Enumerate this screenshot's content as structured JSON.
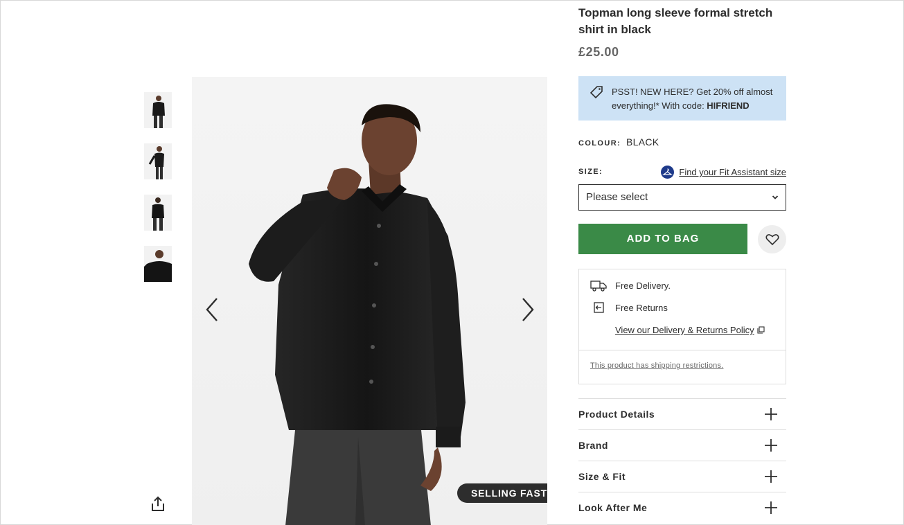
{
  "product": {
    "title": "Topman long sleeve formal stretch shirt in black",
    "price": "£25.00"
  },
  "promo": {
    "text": "PSST! NEW HERE? Get 20% off almost everything!* With code: ",
    "code": "HIFRIEND"
  },
  "colour": {
    "label": "COLOUR:",
    "value": "BLACK"
  },
  "size": {
    "label": "SIZE:",
    "fit_link": "Find your Fit Assistant size",
    "select_value": "Please select"
  },
  "actions": {
    "add_to_bag": "ADD TO BAG"
  },
  "delivery": {
    "free_delivery": "Free Delivery.",
    "free_returns": "Free Returns",
    "policy_link": "View our Delivery & Returns Policy",
    "shipping_note": "This product has shipping restrictions."
  },
  "accordion": [
    {
      "label": "Product Details"
    },
    {
      "label": "Brand"
    },
    {
      "label": "Size & Fit"
    },
    {
      "label": "Look After Me"
    }
  ],
  "gallery": {
    "badge": "SELLING FAST",
    "thumbnail_count": 4
  },
  "icons": {
    "tag": "tag-icon",
    "hanger": "hanger-icon",
    "chevron": "chevron-down-icon",
    "heart": "heart-icon",
    "truck": "truck-icon",
    "returns": "returns-icon",
    "external": "external-link-icon",
    "plus": "plus-icon",
    "share": "share-icon",
    "prev": "chevron-left-icon",
    "next": "chevron-right-icon"
  },
  "colors": {
    "add_to_bag_bg": "#3a8a47",
    "promo_bg": "#cde2f5",
    "text": "#2d2d2d",
    "badge_bg": "#2d2d2d"
  }
}
